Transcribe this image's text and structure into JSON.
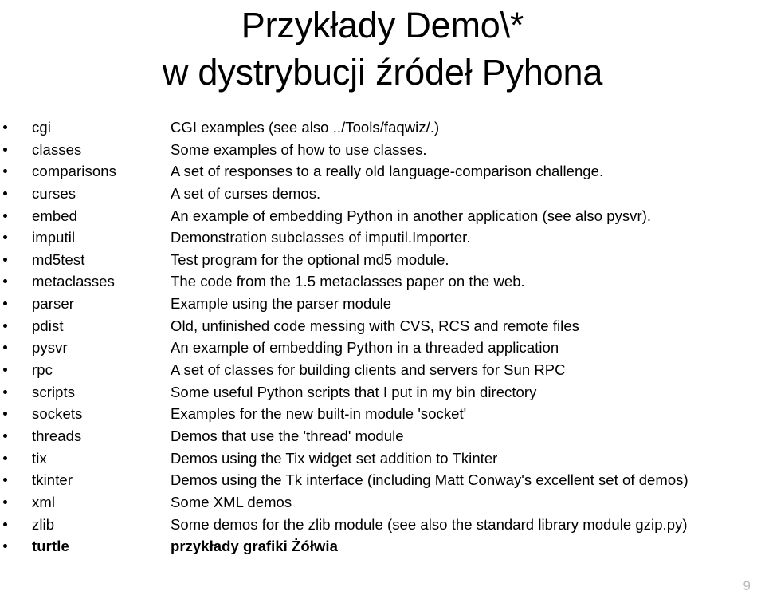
{
  "slide": {
    "title_lines": [
      "Przykłady Demo\\*",
      "w dystrybucji źródeł Pyhona"
    ],
    "page_number": "9",
    "colors": {
      "text": "#000000",
      "background": "#ffffff",
      "page_number": "#b9b9b9"
    },
    "rows": [
      {
        "name": "cgi",
        "desc": "CGI examples (see also ../Tools/faqwiz/.)",
        "bold": false
      },
      {
        "name": "classes",
        "desc": "Some examples of how to use classes.",
        "bold": false
      },
      {
        "name": "comparisons",
        "desc": "A set of responses to a really old language-comparison challenge.",
        "bold": false
      },
      {
        "name": "curses",
        "desc": "A set of curses demos.",
        "bold": false
      },
      {
        "name": "embed",
        "desc": "An example of embedding Python in another application (see also pysvr).",
        "bold": false
      },
      {
        "name": "imputil",
        "desc": "Demonstration subclasses of imputil.Importer.",
        "bold": false
      },
      {
        "name": "md5test",
        "desc": "Test program for the optional md5 module.",
        "bold": false
      },
      {
        "name": "metaclasses",
        "desc": "The code from the 1.5 metaclasses paper on the web.",
        "bold": false
      },
      {
        "name": "parser",
        "desc": "Example using the parser module",
        "bold": false
      },
      {
        "name": "pdist",
        "desc": "Old, unfinished code messing with CVS, RCS and remote files",
        "bold": false
      },
      {
        "name": "pysvr",
        "desc": "An example of embedding Python in a threaded application",
        "bold": false
      },
      {
        "name": "rpc",
        "desc": "A set of classes for building clients and servers for Sun RPC",
        "bold": false
      },
      {
        "name": "scripts",
        "desc": "Some useful Python scripts that I put in my bin directory",
        "bold": false
      },
      {
        "name": "sockets",
        "desc": "Examples for the new built-in module 'socket'",
        "bold": false
      },
      {
        "name": "threads",
        "desc": "Demos that use the 'thread' module",
        "bold": false
      },
      {
        "name": "tix",
        "desc": "Demos using the Tix widget set addition to Tkinter",
        "bold": false
      },
      {
        "name": "tkinter",
        "desc": "Demos using the Tk interface (including Matt Conway's excellent set of demos)",
        "bold": false
      },
      {
        "name": "xml",
        "desc": "Some XML demos",
        "bold": false
      },
      {
        "name": "zlib",
        "desc": "Some demos for the zlib module (see also the standard library module gzip.py)",
        "bold": false
      },
      {
        "name": "turtle",
        "desc": "przykłady grafiki Żółwia",
        "bold": true
      }
    ]
  }
}
